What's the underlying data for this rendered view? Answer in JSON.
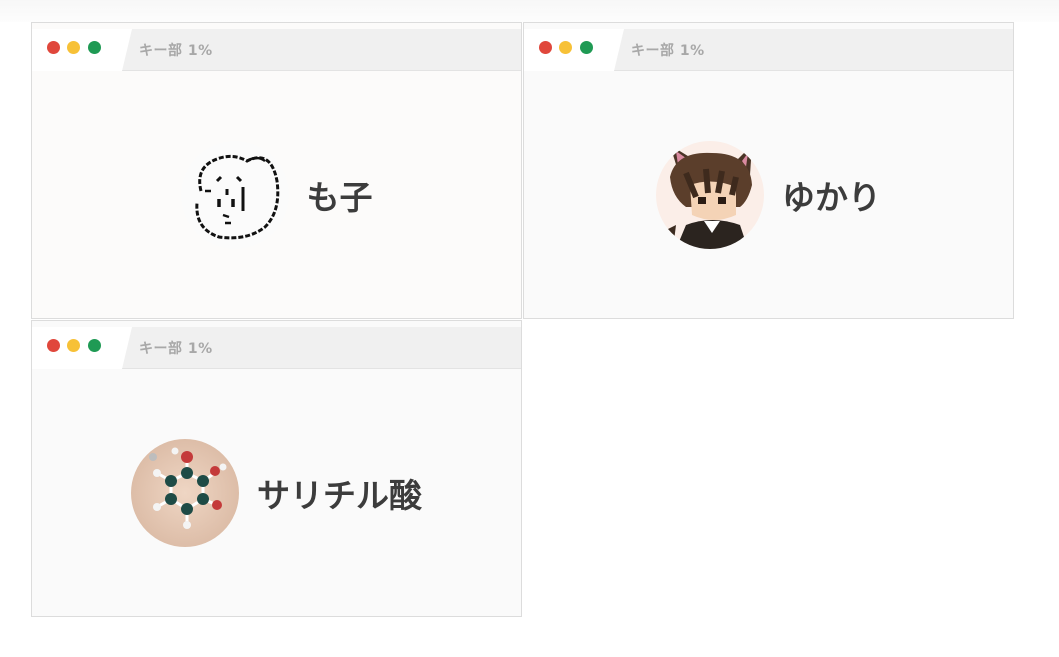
{
  "cards": [
    {
      "tab_label": "キー部 1%",
      "name": "も子",
      "avatar": "doodle-face-avatar"
    },
    {
      "tab_label": "キー部 1%",
      "name": "ゆかり",
      "avatar": "cat-ear-character-avatar"
    },
    {
      "tab_label": "キー部 1%",
      "name": "サリチル酸",
      "avatar": "molecule-model-avatar"
    }
  ],
  "colors": {
    "dot_red": "#e0473c",
    "dot_yellow": "#f7c137",
    "dot_green": "#1f9a54",
    "name_text": "#3c3c3c",
    "tab_text": "#a8a8a8"
  }
}
